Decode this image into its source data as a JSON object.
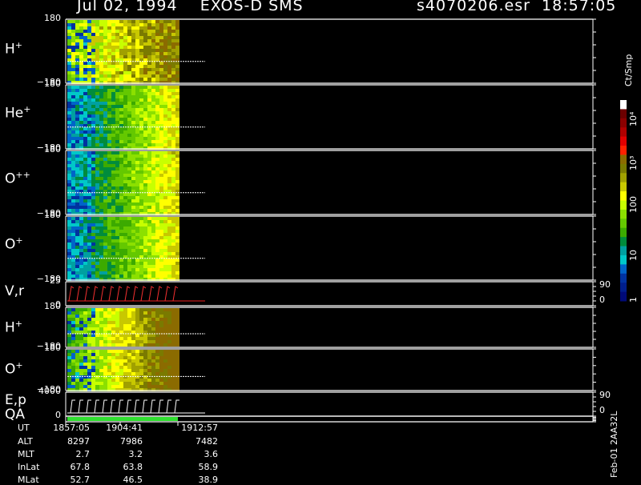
{
  "header": {
    "title": "Jul 02, 1994    EXOS-D SMS",
    "file_info": "s4070206.esr  18:57:05"
  },
  "panels": [
    {
      "id": "h1",
      "label": "H",
      "sup": "+",
      "ticks": [
        "180",
        "−180"
      ],
      "rticks": []
    },
    {
      "id": "he",
      "label": "He",
      "sup": "+",
      "ticks": [
        "180",
        "−180"
      ],
      "rticks": []
    },
    {
      "id": "opp",
      "label": "O",
      "sup": "++",
      "ticks": [
        "180",
        "−180"
      ],
      "rticks": []
    },
    {
      "id": "o1",
      "label": "O",
      "sup": "+",
      "ticks": [
        "180",
        "−180"
      ],
      "rticks": []
    },
    {
      "id": "vr",
      "label": "V,r",
      "sup": "",
      "ticks": [
        "25",
        "0"
      ],
      "rticks": [
        "90",
        "0"
      ]
    },
    {
      "id": "h2",
      "label": "H",
      "sup": "+",
      "ticks": [
        "180",
        "−180"
      ],
      "rticks": []
    },
    {
      "id": "o2",
      "label": "O",
      "sup": "+",
      "ticks": [
        "180",
        "−180"
      ],
      "rticks": []
    },
    {
      "id": "ep",
      "label": "E,p",
      "sup": "",
      "ticks": [
        "4000",
        "0"
      ],
      "rticks": [
        "90",
        "0"
      ]
    },
    {
      "id": "qa",
      "label": "QA",
      "sup": "",
      "ticks": [],
      "rticks": []
    }
  ],
  "colorbar": {
    "label": "Ct/Smp",
    "ticks": [
      "10⁴",
      "10³",
      "100",
      "10",
      "1"
    ],
    "colors": [
      "#ffffff",
      "#6b0000",
      "#8b0000",
      "#b00000",
      "#e00000",
      "#ff2000",
      "#8b6b00",
      "#7a7a00",
      "#a0a000",
      "#c8c800",
      "#ffff00",
      "#c8ff00",
      "#8ce000",
      "#64c800",
      "#3caa00",
      "#008c3c",
      "#00a0a0",
      "#00c8c8",
      "#0064c8",
      "#0032a0",
      "#001e8c",
      "#000a78"
    ]
  },
  "ephemeris": {
    "labels": [
      "UT",
      "ALT",
      "MLT",
      "InLat",
      "MLat"
    ],
    "columns": [
      [
        "1857:05",
        "8297",
        "2.7",
        "67.8",
        "52.7"
      ],
      [
        "1904:41",
        "7986",
        "3.2",
        "63.8",
        "46.5"
      ],
      [
        "1912:57",
        "7482",
        "3.6",
        "58.9",
        "38.9"
      ]
    ]
  },
  "side_id": "Feb-01 2AA32L",
  "chart_data": {
    "type": "heatmap",
    "title": "Jul 02, 1994    EXOS-D SMS",
    "subtitle": "s4070206.esr  18:57:05",
    "x_ticks": [
      "1857:05",
      "1904:41",
      "1912:57"
    ],
    "colorbar_label": "Ct/Smp",
    "colorbar_scale": "log",
    "colorbar_range": [
      1,
      10000
    ],
    "panels": [
      "H+",
      "He+",
      "O++",
      "O+",
      "V,r",
      "H+",
      "O+",
      "E,p",
      "QA"
    ]
  }
}
